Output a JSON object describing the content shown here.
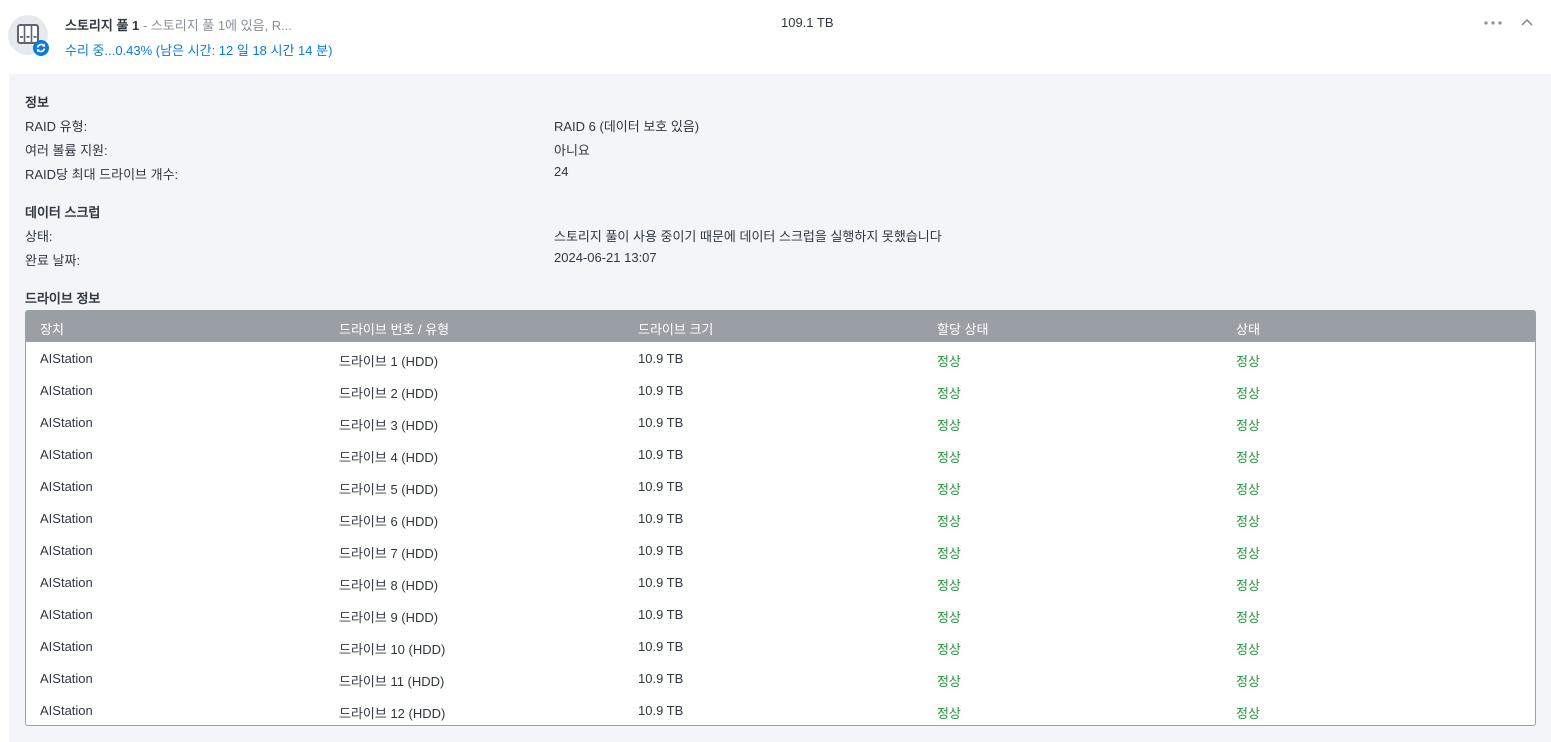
{
  "pool": {
    "name": "스토리지 풀 1",
    "description": " - 스토리지 풀 1에 있음, R...",
    "size": "109.1 TB",
    "status": "수리 중...0.43% (남은 시간: 12 일 18 시간 14 분)",
    "icon": "storage-pool-repairing-icon"
  },
  "toolbar": {
    "more_icon": "more-dots-icon",
    "collapse_icon": "chevron-up-icon"
  },
  "info": {
    "title": "정보",
    "rows": [
      {
        "label": "RAID 유형:",
        "value": "RAID 6 (데이터 보호 있음)"
      },
      {
        "label": "여러 볼륨 지원:",
        "value": "아니요"
      },
      {
        "label": "RAID당 최대 드라이브 개수:",
        "value": "24"
      }
    ]
  },
  "scrub": {
    "title": "데이터 스크럽",
    "rows": [
      {
        "label": "상태:",
        "value": "스토리지 풀이 사용 중이기 때문에 데이터 스크럽을 실행하지 못했습니다"
      },
      {
        "label": "완료 날짜:",
        "value": "2024-06-21 13:07"
      }
    ]
  },
  "drives": {
    "title": "드라이브 정보",
    "columns": [
      "장치",
      "드라이브 번호 / 유형",
      "드라이브 크기",
      "할당 상태",
      "상태"
    ],
    "rows": [
      [
        "AIStation",
        "드라이브 1 (HDD)",
        "10.9 TB",
        "정상",
        "정상"
      ],
      [
        "AIStation",
        "드라이브 2 (HDD)",
        "10.9 TB",
        "정상",
        "정상"
      ],
      [
        "AIStation",
        "드라이브 3 (HDD)",
        "10.9 TB",
        "정상",
        "정상"
      ],
      [
        "AIStation",
        "드라이브 4 (HDD)",
        "10.9 TB",
        "정상",
        "정상"
      ],
      [
        "AIStation",
        "드라이브 5 (HDD)",
        "10.9 TB",
        "정상",
        "정상"
      ],
      [
        "AIStation",
        "드라이브 6 (HDD)",
        "10.9 TB",
        "정상",
        "정상"
      ],
      [
        "AIStation",
        "드라이브 7 (HDD)",
        "10.9 TB",
        "정상",
        "정상"
      ],
      [
        "AIStation",
        "드라이브 8 (HDD)",
        "10.9 TB",
        "정상",
        "정상"
      ],
      [
        "AIStation",
        "드라이브 9 (HDD)",
        "10.9 TB",
        "정상",
        "정상"
      ],
      [
        "AIStation",
        "드라이브 10 (HDD)",
        "10.9 TB",
        "정상",
        "정상"
      ],
      [
        "AIStation",
        "드라이브 11 (HDD)",
        "10.9 TB",
        "정상",
        "정상"
      ],
      [
        "AIStation",
        "드라이브 12 (HDD)",
        "10.9 TB",
        "정상",
        "정상"
      ]
    ]
  },
  "colors": {
    "accent": "#0b7ad9",
    "ok": "#1f9a3c",
    "table_header": "#9a9fa6",
    "panel": "#f4f5f8"
  }
}
